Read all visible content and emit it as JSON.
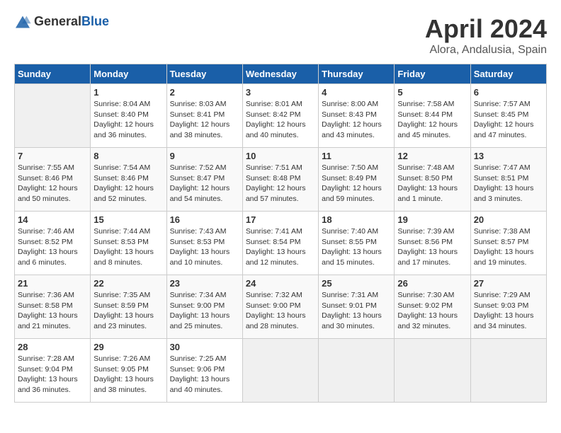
{
  "header": {
    "logo_general": "General",
    "logo_blue": "Blue",
    "title": "April 2024",
    "location": "Alora, Andalusia, Spain"
  },
  "weekdays": [
    "Sunday",
    "Monday",
    "Tuesday",
    "Wednesday",
    "Thursday",
    "Friday",
    "Saturday"
  ],
  "weeks": [
    [
      {
        "day": "",
        "empty": true
      },
      {
        "day": "1",
        "sunrise": "Sunrise: 8:04 AM",
        "sunset": "Sunset: 8:40 PM",
        "daylight": "Daylight: 12 hours and 36 minutes."
      },
      {
        "day": "2",
        "sunrise": "Sunrise: 8:03 AM",
        "sunset": "Sunset: 8:41 PM",
        "daylight": "Daylight: 12 hours and 38 minutes."
      },
      {
        "day": "3",
        "sunrise": "Sunrise: 8:01 AM",
        "sunset": "Sunset: 8:42 PM",
        "daylight": "Daylight: 12 hours and 40 minutes."
      },
      {
        "day": "4",
        "sunrise": "Sunrise: 8:00 AM",
        "sunset": "Sunset: 8:43 PM",
        "daylight": "Daylight: 12 hours and 43 minutes."
      },
      {
        "day": "5",
        "sunrise": "Sunrise: 7:58 AM",
        "sunset": "Sunset: 8:44 PM",
        "daylight": "Daylight: 12 hours and 45 minutes."
      },
      {
        "day": "6",
        "sunrise": "Sunrise: 7:57 AM",
        "sunset": "Sunset: 8:45 PM",
        "daylight": "Daylight: 12 hours and 47 minutes."
      }
    ],
    [
      {
        "day": "7",
        "sunrise": "Sunrise: 7:55 AM",
        "sunset": "Sunset: 8:46 PM",
        "daylight": "Daylight: 12 hours and 50 minutes."
      },
      {
        "day": "8",
        "sunrise": "Sunrise: 7:54 AM",
        "sunset": "Sunset: 8:46 PM",
        "daylight": "Daylight: 12 hours and 52 minutes."
      },
      {
        "day": "9",
        "sunrise": "Sunrise: 7:52 AM",
        "sunset": "Sunset: 8:47 PM",
        "daylight": "Daylight: 12 hours and 54 minutes."
      },
      {
        "day": "10",
        "sunrise": "Sunrise: 7:51 AM",
        "sunset": "Sunset: 8:48 PM",
        "daylight": "Daylight: 12 hours and 57 minutes."
      },
      {
        "day": "11",
        "sunrise": "Sunrise: 7:50 AM",
        "sunset": "Sunset: 8:49 PM",
        "daylight": "Daylight: 12 hours and 59 minutes."
      },
      {
        "day": "12",
        "sunrise": "Sunrise: 7:48 AM",
        "sunset": "Sunset: 8:50 PM",
        "daylight": "Daylight: 13 hours and 1 minute."
      },
      {
        "day": "13",
        "sunrise": "Sunrise: 7:47 AM",
        "sunset": "Sunset: 8:51 PM",
        "daylight": "Daylight: 13 hours and 3 minutes."
      }
    ],
    [
      {
        "day": "14",
        "sunrise": "Sunrise: 7:46 AM",
        "sunset": "Sunset: 8:52 PM",
        "daylight": "Daylight: 13 hours and 6 minutes."
      },
      {
        "day": "15",
        "sunrise": "Sunrise: 7:44 AM",
        "sunset": "Sunset: 8:53 PM",
        "daylight": "Daylight: 13 hours and 8 minutes."
      },
      {
        "day": "16",
        "sunrise": "Sunrise: 7:43 AM",
        "sunset": "Sunset: 8:53 PM",
        "daylight": "Daylight: 13 hours and 10 minutes."
      },
      {
        "day": "17",
        "sunrise": "Sunrise: 7:41 AM",
        "sunset": "Sunset: 8:54 PM",
        "daylight": "Daylight: 13 hours and 12 minutes."
      },
      {
        "day": "18",
        "sunrise": "Sunrise: 7:40 AM",
        "sunset": "Sunset: 8:55 PM",
        "daylight": "Daylight: 13 hours and 15 minutes."
      },
      {
        "day": "19",
        "sunrise": "Sunrise: 7:39 AM",
        "sunset": "Sunset: 8:56 PM",
        "daylight": "Daylight: 13 hours and 17 minutes."
      },
      {
        "day": "20",
        "sunrise": "Sunrise: 7:38 AM",
        "sunset": "Sunset: 8:57 PM",
        "daylight": "Daylight: 13 hours and 19 minutes."
      }
    ],
    [
      {
        "day": "21",
        "sunrise": "Sunrise: 7:36 AM",
        "sunset": "Sunset: 8:58 PM",
        "daylight": "Daylight: 13 hours and 21 minutes."
      },
      {
        "day": "22",
        "sunrise": "Sunrise: 7:35 AM",
        "sunset": "Sunset: 8:59 PM",
        "daylight": "Daylight: 13 hours and 23 minutes."
      },
      {
        "day": "23",
        "sunrise": "Sunrise: 7:34 AM",
        "sunset": "Sunset: 9:00 PM",
        "daylight": "Daylight: 13 hours and 25 minutes."
      },
      {
        "day": "24",
        "sunrise": "Sunrise: 7:32 AM",
        "sunset": "Sunset: 9:00 PM",
        "daylight": "Daylight: 13 hours and 28 minutes."
      },
      {
        "day": "25",
        "sunrise": "Sunrise: 7:31 AM",
        "sunset": "Sunset: 9:01 PM",
        "daylight": "Daylight: 13 hours and 30 minutes."
      },
      {
        "day": "26",
        "sunrise": "Sunrise: 7:30 AM",
        "sunset": "Sunset: 9:02 PM",
        "daylight": "Daylight: 13 hours and 32 minutes."
      },
      {
        "day": "27",
        "sunrise": "Sunrise: 7:29 AM",
        "sunset": "Sunset: 9:03 PM",
        "daylight": "Daylight: 13 hours and 34 minutes."
      }
    ],
    [
      {
        "day": "28",
        "sunrise": "Sunrise: 7:28 AM",
        "sunset": "Sunset: 9:04 PM",
        "daylight": "Daylight: 13 hours and 36 minutes."
      },
      {
        "day": "29",
        "sunrise": "Sunrise: 7:26 AM",
        "sunset": "Sunset: 9:05 PM",
        "daylight": "Daylight: 13 hours and 38 minutes."
      },
      {
        "day": "30",
        "sunrise": "Sunrise: 7:25 AM",
        "sunset": "Sunset: 9:06 PM",
        "daylight": "Daylight: 13 hours and 40 minutes."
      },
      {
        "day": "",
        "empty": true
      },
      {
        "day": "",
        "empty": true
      },
      {
        "day": "",
        "empty": true
      },
      {
        "day": "",
        "empty": true
      }
    ]
  ]
}
